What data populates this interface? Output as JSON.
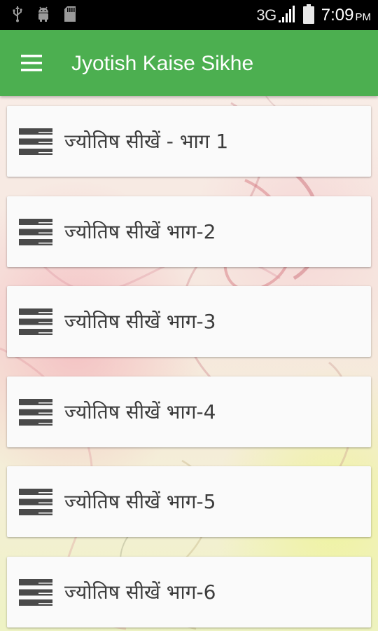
{
  "status_bar": {
    "network": "3G",
    "time": "7:09",
    "ampm": "PM",
    "left_icons": [
      "usb-icon",
      "android-debug-icon",
      "sd-card-icon"
    ],
    "right_icons": [
      "signal-icon",
      "battery-icon"
    ]
  },
  "toolbar": {
    "title": "Jyotish Kaise Sikhe",
    "menu_icon": "hamburger-menu-icon",
    "color": "#4caf50"
  },
  "list": {
    "item_icon": "list-lines-icon",
    "items": [
      {
        "label": "ज्योतिष सीखें - भाग 1"
      },
      {
        "label": "ज्योतिष सीखें भाग-2"
      },
      {
        "label": "ज्योतिष सीखें भाग-3"
      },
      {
        "label": "ज्योतिष सीखें भाग-4"
      },
      {
        "label": "ज्योतिष सीखें भाग-5"
      },
      {
        "label": "ज्योतिष सीखें भाग-6"
      }
    ]
  }
}
